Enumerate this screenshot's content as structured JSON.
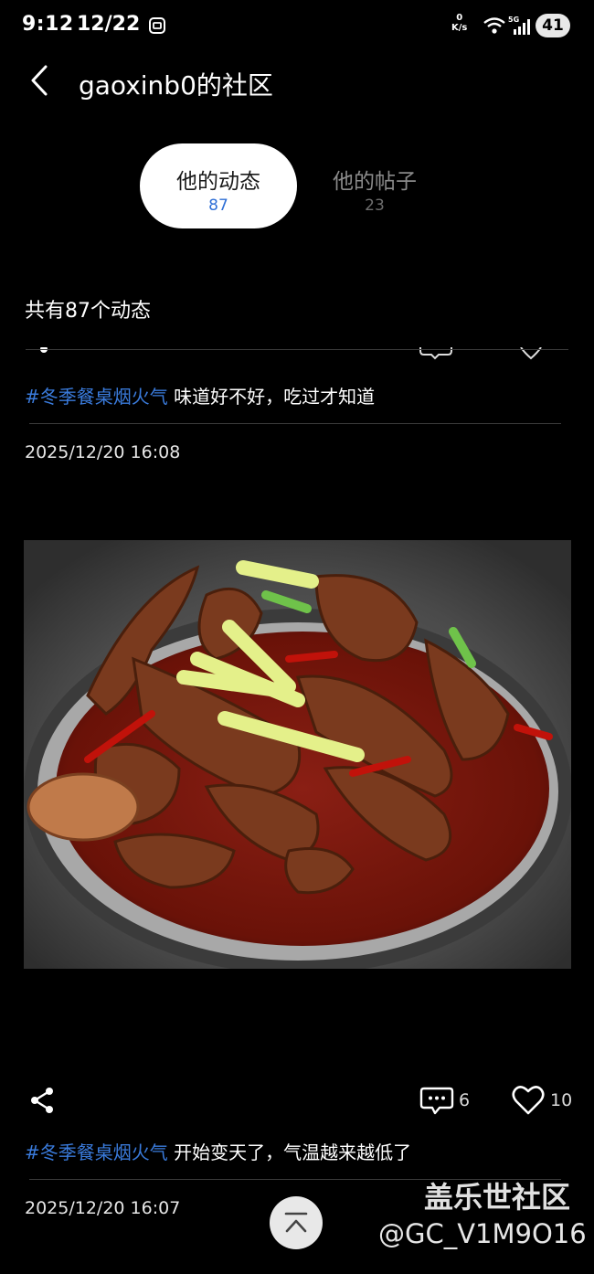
{
  "status_bar": {
    "time": "9:12",
    "date": "12/22",
    "net_speed_value": "0",
    "net_speed_unit": "K/s",
    "network": "5G",
    "battery": "41"
  },
  "header": {
    "title": "gaoxinb0的社区"
  },
  "tabs": [
    {
      "label": "他的动态",
      "count": "87",
      "active": true
    },
    {
      "label": "他的帖子",
      "count": "23",
      "active": false
    }
  ],
  "summary": "共有87个动态",
  "posts": [
    {
      "tag": "#冬季餐桌烟火气",
      "text": " 味道好不好，吃过才知道",
      "timestamp": "2025/12/20 16:08",
      "image_icon": "braised-duck-stew-photo",
      "comments": "6",
      "likes": "10"
    },
    {
      "tag": "#冬季餐桌烟火气",
      "text": " 开始变天了，气温越来越低了",
      "timestamp": "2025/12/20 16:07"
    }
  ],
  "watermark": {
    "site": "盖乐世社区",
    "user": "@GC_V1M9O16"
  },
  "colors": {
    "background": "#000000",
    "hashtag": "#3a7bdc",
    "active_count": "#2f6fd6",
    "tab_active_bg": "#ffffff"
  }
}
